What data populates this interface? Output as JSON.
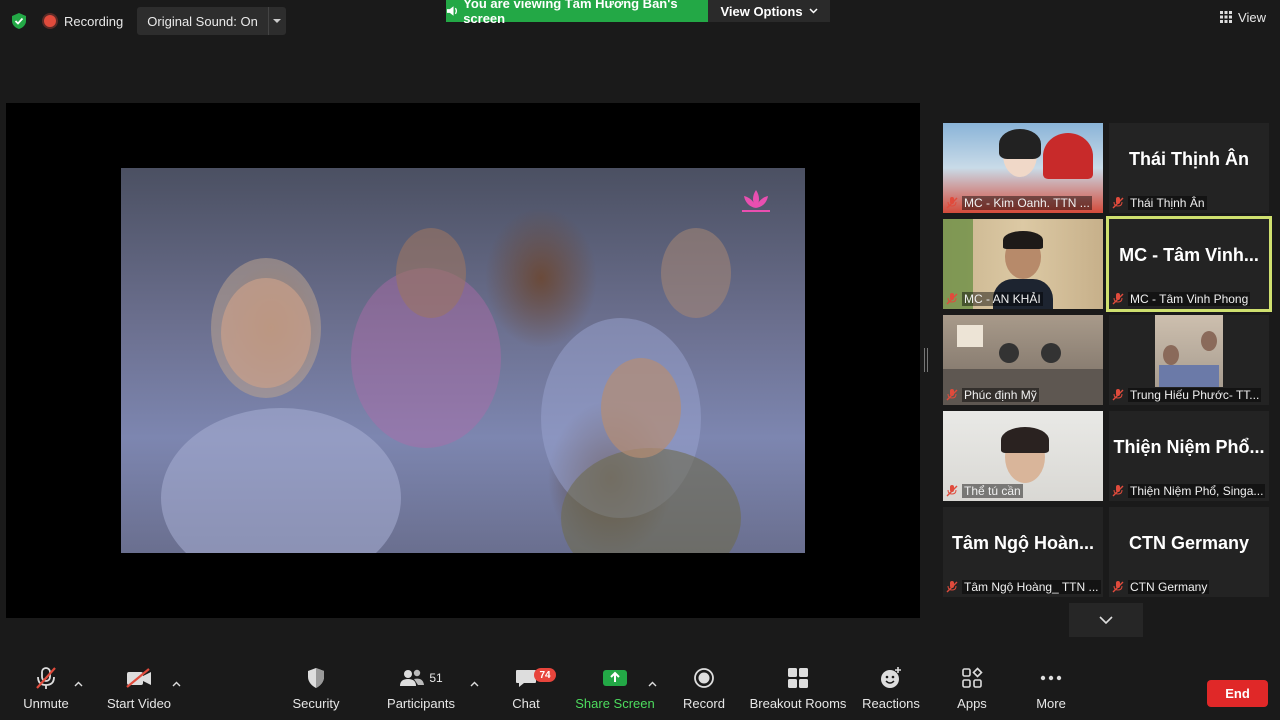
{
  "topbar": {
    "recording_label": "Recording",
    "original_sound_label": "Original Sound: On",
    "viewing_banner": "You are viewing Tâm Hương Bản's screen",
    "view_options_label": "View Options",
    "view_label": "View"
  },
  "gallery": {
    "tiles": [
      {
        "name": "MC - Kim Oanh. TTN ...",
        "display": "",
        "muted": true
      },
      {
        "name": "Thái Thịnh Ân",
        "display": "Thái Thịnh Ân",
        "muted": true
      },
      {
        "name": "MC - AN KHẢI",
        "display": "",
        "muted": true
      },
      {
        "name": "MC - Tâm Vinh Phong",
        "display": "MC - Tâm Vinh...",
        "muted": true,
        "active": true
      },
      {
        "name": "Phúc định Mỹ",
        "display": "",
        "muted": true
      },
      {
        "name": "Trung Hiếu Phước- TT...",
        "display": "",
        "muted": true
      },
      {
        "name": "Thể tú cần",
        "display": "",
        "muted": true
      },
      {
        "name": "Thiện Niệm Phổ, Singa...",
        "display": "Thiện Niệm Phổ...",
        "muted": true
      },
      {
        "name": "Tâm Ngộ Hoàng_ TTN ...",
        "display": "Tâm Ngộ Hoàn...",
        "muted": true
      },
      {
        "name": "CTN Germany",
        "display": "CTN Germany",
        "muted": true
      }
    ]
  },
  "toolbar": {
    "unmute": "Unmute",
    "start_video": "Start Video",
    "security": "Security",
    "participants": "Participants",
    "participants_count": "51",
    "chat": "Chat",
    "chat_badge": "74",
    "share_screen": "Share Screen",
    "record": "Record",
    "breakout_rooms": "Breakout Rooms",
    "reactions": "Reactions",
    "apps": "Apps",
    "more": "More",
    "end": "End"
  },
  "colors": {
    "share_green": "#23a846",
    "end_red": "#e02828",
    "active_border": "#cfe06f",
    "badge_red": "#e8453c"
  }
}
